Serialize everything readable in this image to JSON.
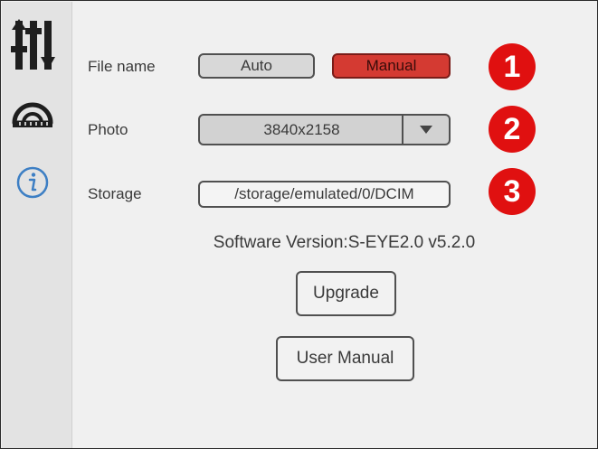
{
  "sidebar": {
    "items": [
      {
        "icon": "sliders-icon",
        "name": "settings"
      },
      {
        "icon": "protractor-icon",
        "name": "measurement"
      },
      {
        "icon": "info-icon",
        "name": "about"
      }
    ]
  },
  "settings": {
    "file_name": {
      "label": "File name",
      "options": [
        "Auto",
        "Manual"
      ],
      "selected": "Manual"
    },
    "photo": {
      "label": "Photo",
      "value": "3840x2158"
    },
    "storage": {
      "label": "Storage",
      "value": "/storage/emulated/0/DCIM"
    }
  },
  "callouts": [
    "1",
    "2",
    "3"
  ],
  "software_version": "Software Version:S-EYE2.0 v5.2.0",
  "buttons": {
    "upgrade": "Upgrade",
    "user_manual": "User Manual"
  },
  "colors": {
    "selected": "#d43a32",
    "callout": "#e01010",
    "icon_dark": "#1e1e1e",
    "info_blue": "#3d7fc4"
  }
}
